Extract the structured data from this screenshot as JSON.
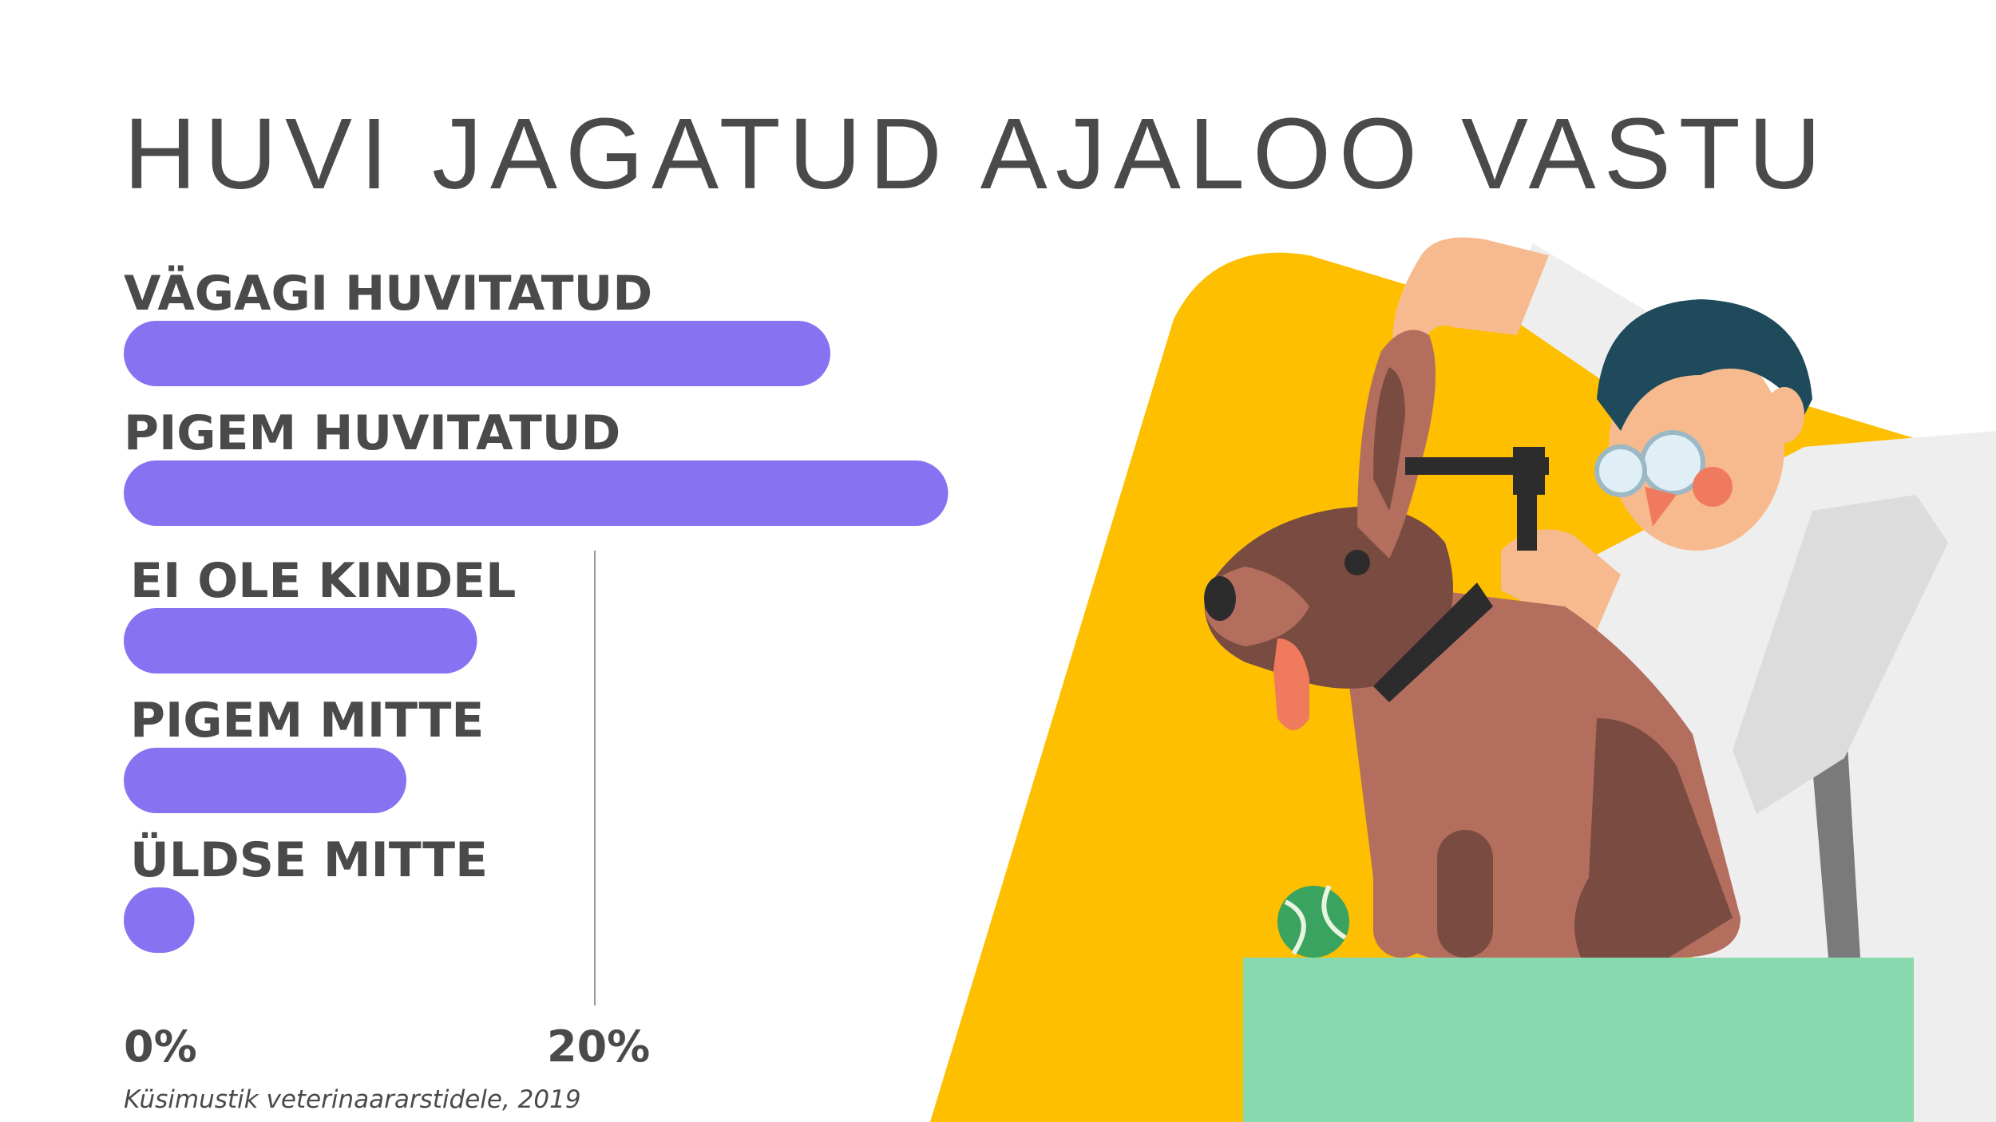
{
  "colors": {
    "bar": "#8772f2",
    "text": "#4a4a4a",
    "gridline": "#999999",
    "background_shape": "#fdbf00",
    "table": "#88d9ad"
  },
  "chart_data": {
    "type": "bar",
    "orientation": "horizontal",
    "title": "HUVI JAGATUD AJALOO VASTU",
    "categories": [
      "VÄGAGI HUVITATUD",
      "PIGEM HUVITATUD",
      "EI OLE KINDEL",
      "PIGEM MITTE",
      "ÜLDSE MITTE"
    ],
    "values": [
      30,
      35,
      15,
      12,
      3
    ],
    "xlim": [
      0,
      40
    ],
    "xticks": [
      "0%",
      "20%"
    ],
    "gridline_at": [
      20
    ],
    "legend": "none",
    "source": "Küsimustik veterinaararstidele, 2019"
  },
  "illustration": {
    "subject": "veterinarian examining a dog's ear with an otoscope",
    "icons": [
      "vet-figure",
      "dog-figure",
      "otoscope-icon",
      "tennis-ball-icon",
      "exam-table"
    ]
  }
}
